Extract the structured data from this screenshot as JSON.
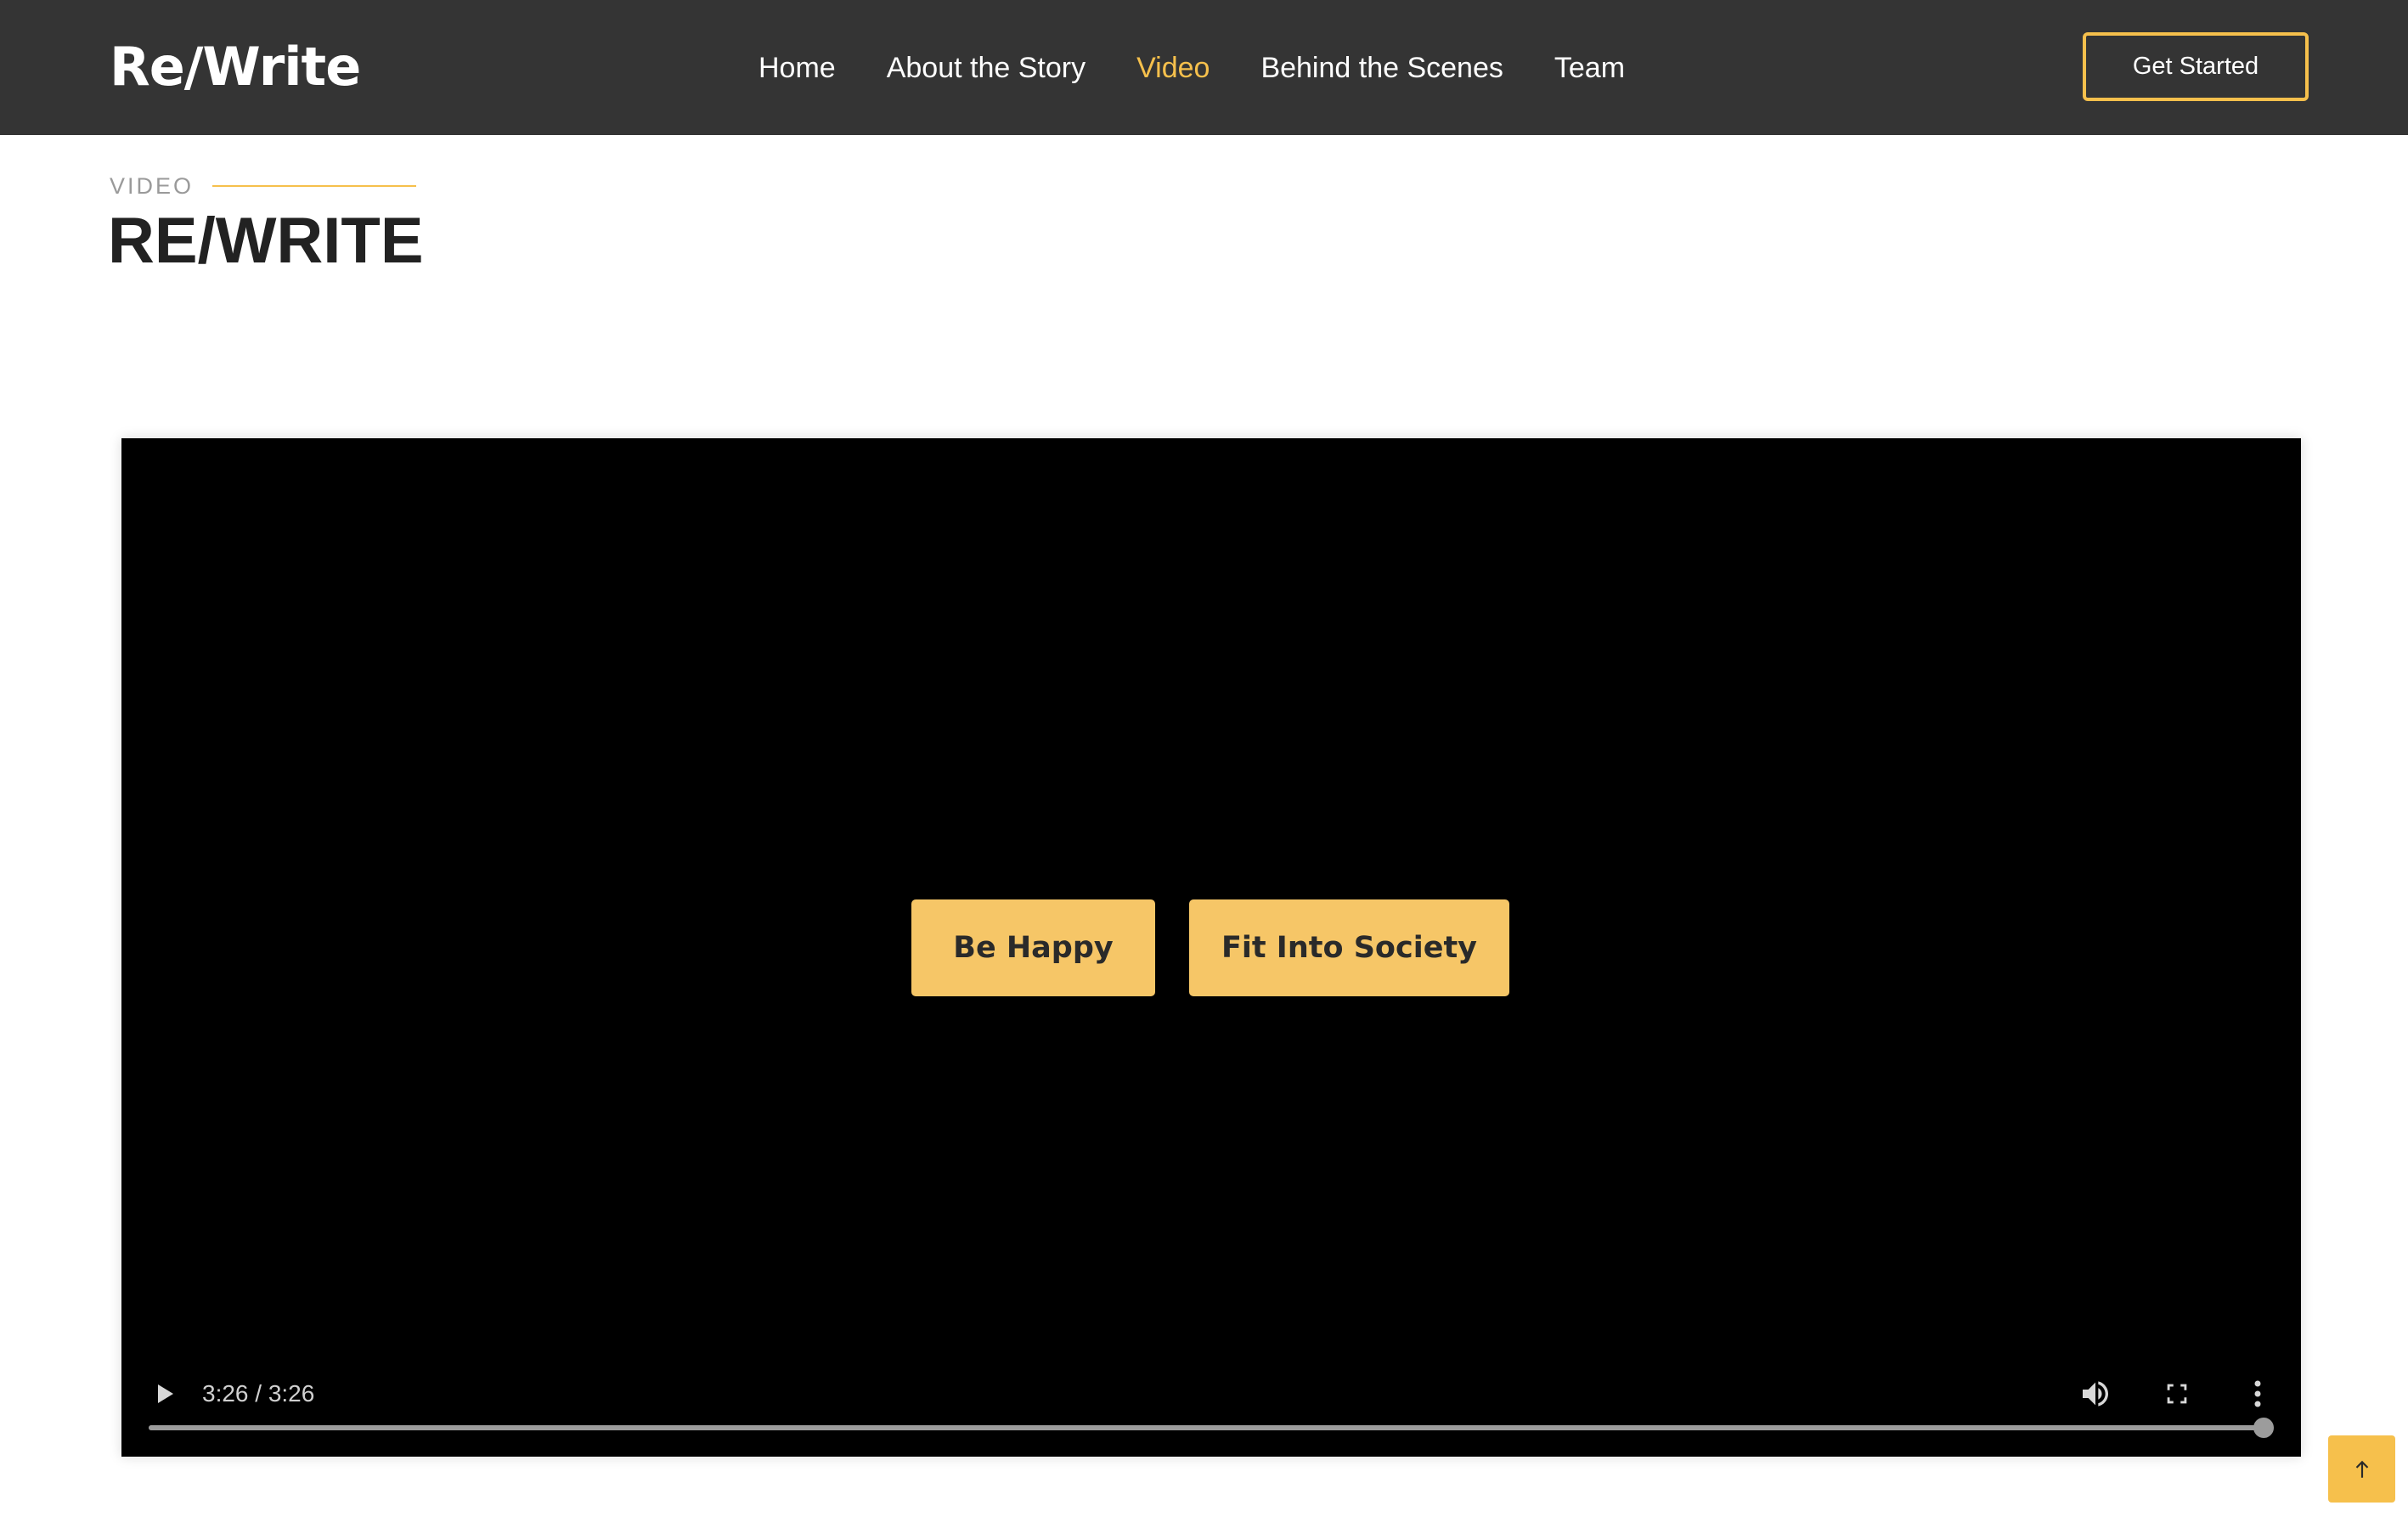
{
  "header": {
    "logo": "Re/Write",
    "nav": [
      {
        "label": "Home",
        "active": false
      },
      {
        "label": "About the Story",
        "active": false
      },
      {
        "label": "Video",
        "active": true
      },
      {
        "label": "Behind the Scenes",
        "active": false
      },
      {
        "label": "Team",
        "active": false
      }
    ],
    "cta_label": "Get Started"
  },
  "section": {
    "label": "VIDEO",
    "title": "RE/WRITE"
  },
  "video": {
    "choices": [
      "Be Happy",
      "Fit Into Society"
    ],
    "current_time": "3:26",
    "duration": "3:26",
    "time_text": "3:26 / 3:26",
    "progress_fraction": 1.0,
    "icons": {
      "play": "play-icon",
      "volume": "volume-icon",
      "fullscreen": "fullscreen-icon",
      "more": "more-vertical-icon"
    }
  },
  "scroll_top": {
    "icon": "arrow-up-icon"
  },
  "colors": {
    "header_bg": "#343434",
    "accent": "#f6c04c",
    "choice_bg": "#f6c667",
    "video_bg": "#000000"
  }
}
